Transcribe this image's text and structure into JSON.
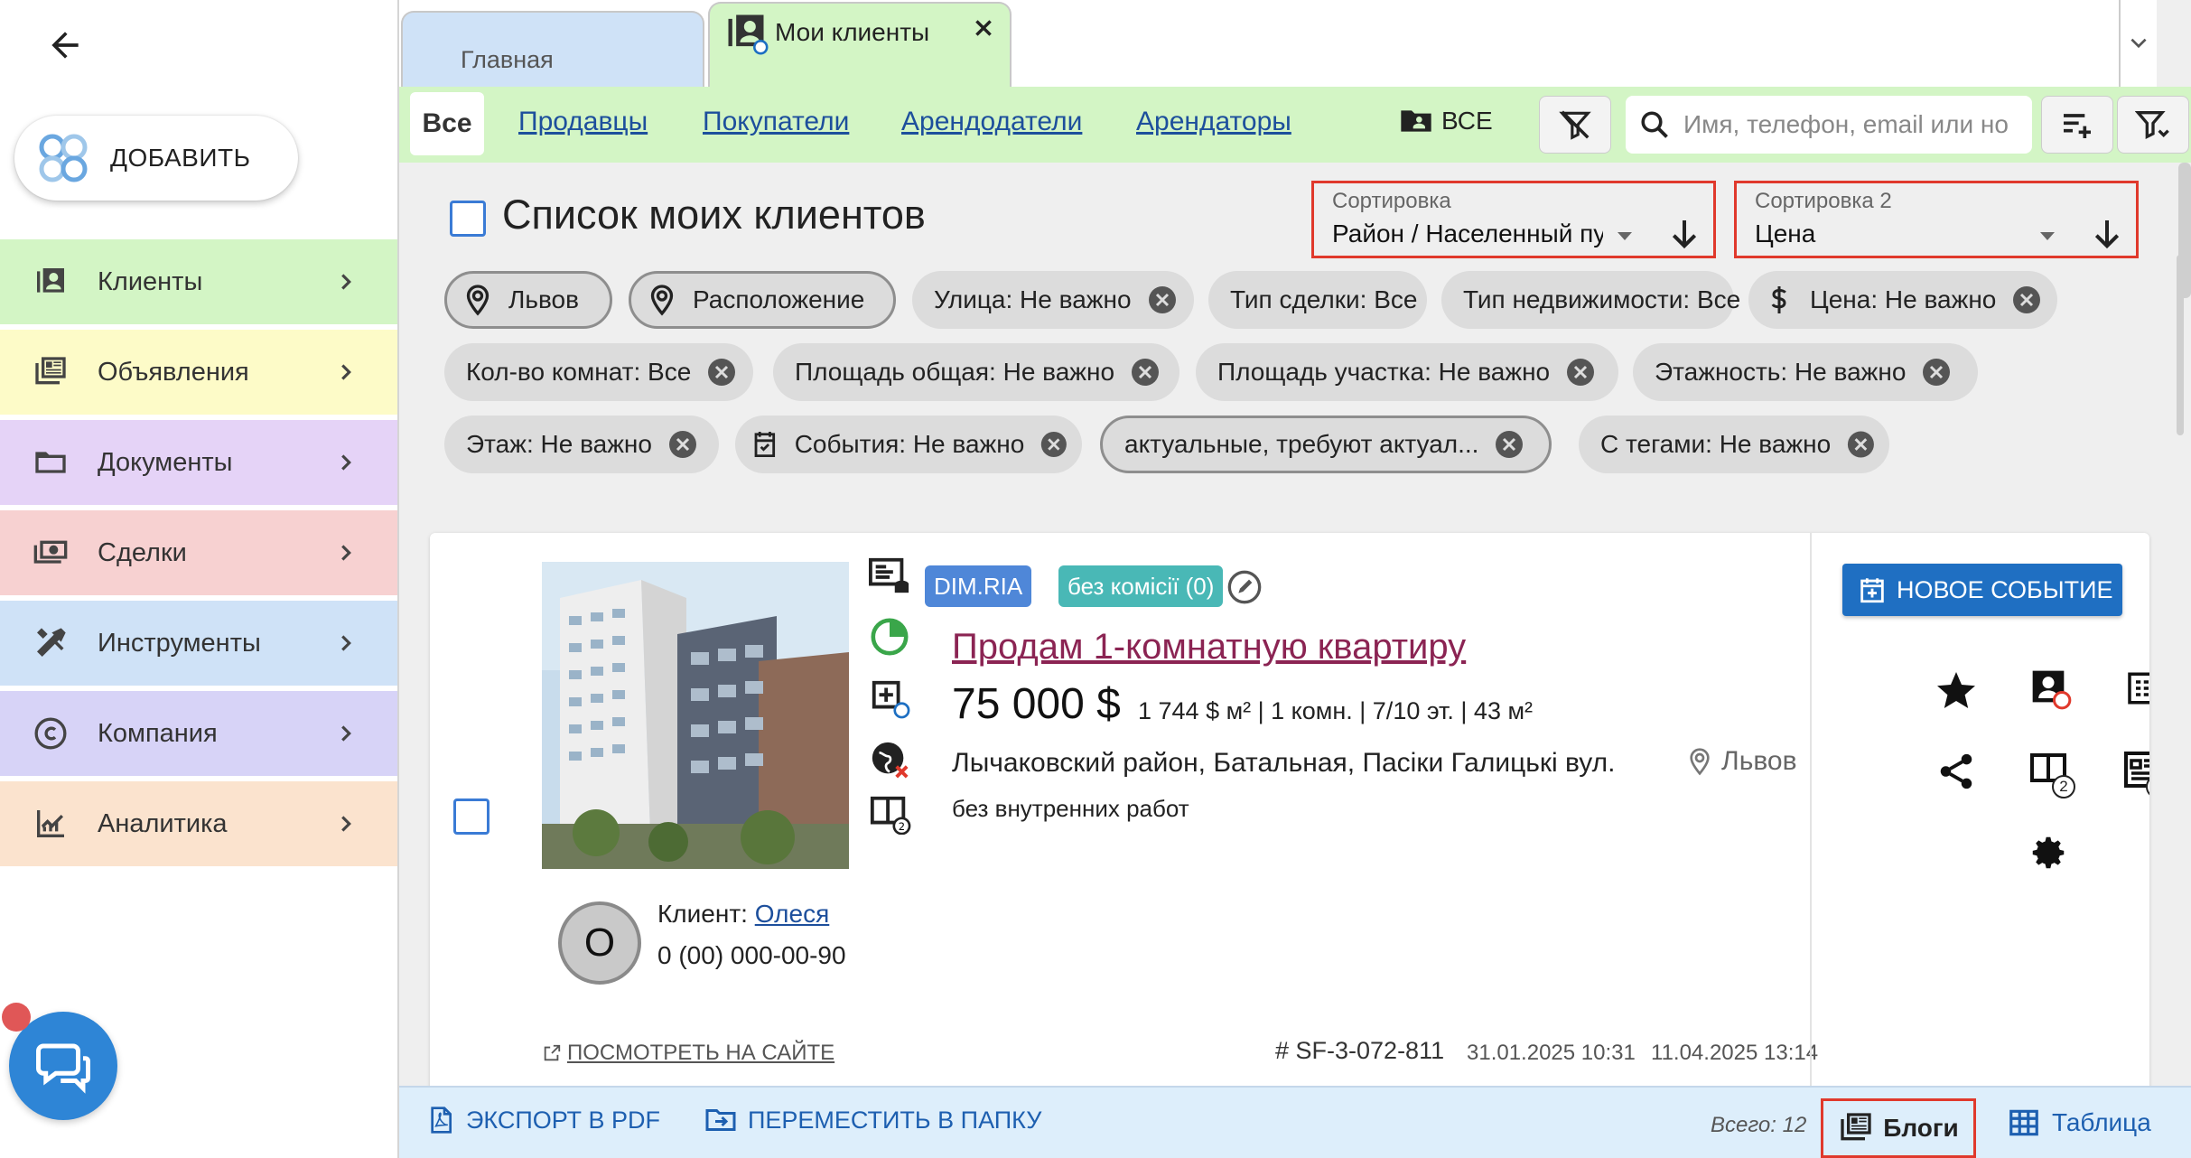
{
  "sidebar": {
    "add_label": "ДОБАВИТЬ",
    "items": [
      {
        "label": "Клиенты",
        "color": "#d3f5c5",
        "icon": "clients-icon"
      },
      {
        "label": "Объявления",
        "color": "#fdfbc8",
        "icon": "listings-icon"
      },
      {
        "label": "Документы",
        "color": "#e5d3f7",
        "icon": "folder-icon"
      },
      {
        "label": "Сделки",
        "color": "#f7d1d1",
        "icon": "deals-icon"
      },
      {
        "label": "Инструменты",
        "color": "#cfe2f7",
        "icon": "tools-icon"
      },
      {
        "label": "Компания",
        "color": "#d7d3f7",
        "icon": "copyright-icon"
      },
      {
        "label": "Аналитика",
        "color": "#fbe3ce",
        "icon": "analytics-icon"
      }
    ]
  },
  "tabs": {
    "home": "Главная",
    "clients": "Мои клиенты"
  },
  "filterbar": {
    "all": "Все",
    "links": [
      "Продавцы",
      "Покупатели",
      "Арендодатели",
      "Арендаторы"
    ],
    "folder_all": "ВСЕ",
    "search_placeholder": "Имя, телефон, email или но"
  },
  "list": {
    "title": "Список моих клиентов",
    "sort1_label": "Сортировка",
    "sort1_value": "Район / Населенный пункт",
    "sort2_label": "Сортировка 2",
    "sort2_value": "Цена"
  },
  "chips": [
    "Львов",
    "Расположение",
    "Улица: Не важно",
    "Тип сделки: Все",
    "Тип недвижимости: Все",
    "Цена: Не важно",
    "Кол-во комнат: Все",
    "Площадь общая: Не важно",
    "Площадь участка: Не важно",
    "Этажность: Не важно",
    "Этаж: Не важно",
    "События: Не важно",
    "актуальные, требуют актуал...",
    "С тегами: Не важно"
  ],
  "card": {
    "source_badge": "DIM.RIA",
    "commission_badge": "без комісії (0)",
    "title": "Продам 1-комнатную квартиру",
    "price": "75 000 $",
    "details": "1 744 $ м² | 1 комн. | 7/10 эт. | 43 м²",
    "address": "Лычаковский район, Батальная, Пасіки Галицькі вул.",
    "location": "Львов",
    "condition": "без внутренних работ",
    "condition_count": "2",
    "client_label": "Клиент:",
    "client_name": "Олеся",
    "client_initial": "О",
    "client_phone": "0 (00) 000-00-90",
    "view_site": "ПОСМОТРЕТЬ НА САЙТЕ",
    "ref_id": "# SF-3-072-811",
    "created": "31.01.2025 10:31",
    "updated": "11.04.2025 13:14",
    "new_event": "НОВОЕ СОБЫТИЕ",
    "docs_count": "2",
    "listings_count": "2"
  },
  "bottombar": {
    "export_pdf": "ЭКСПОРТ В PDF",
    "move_folder": "ПЕРЕМЕСТИТЬ В ПАПКУ",
    "total": "Всего: 12",
    "view_blogs": "Блоги",
    "view_table": "Таблица"
  },
  "colors": {
    "accent_blue": "#1f6fc2",
    "link_blue": "#1d4f9c",
    "title_magenta": "#8b2453",
    "highlight_red": "#e0392c",
    "tab_green": "#d3f5c5"
  }
}
